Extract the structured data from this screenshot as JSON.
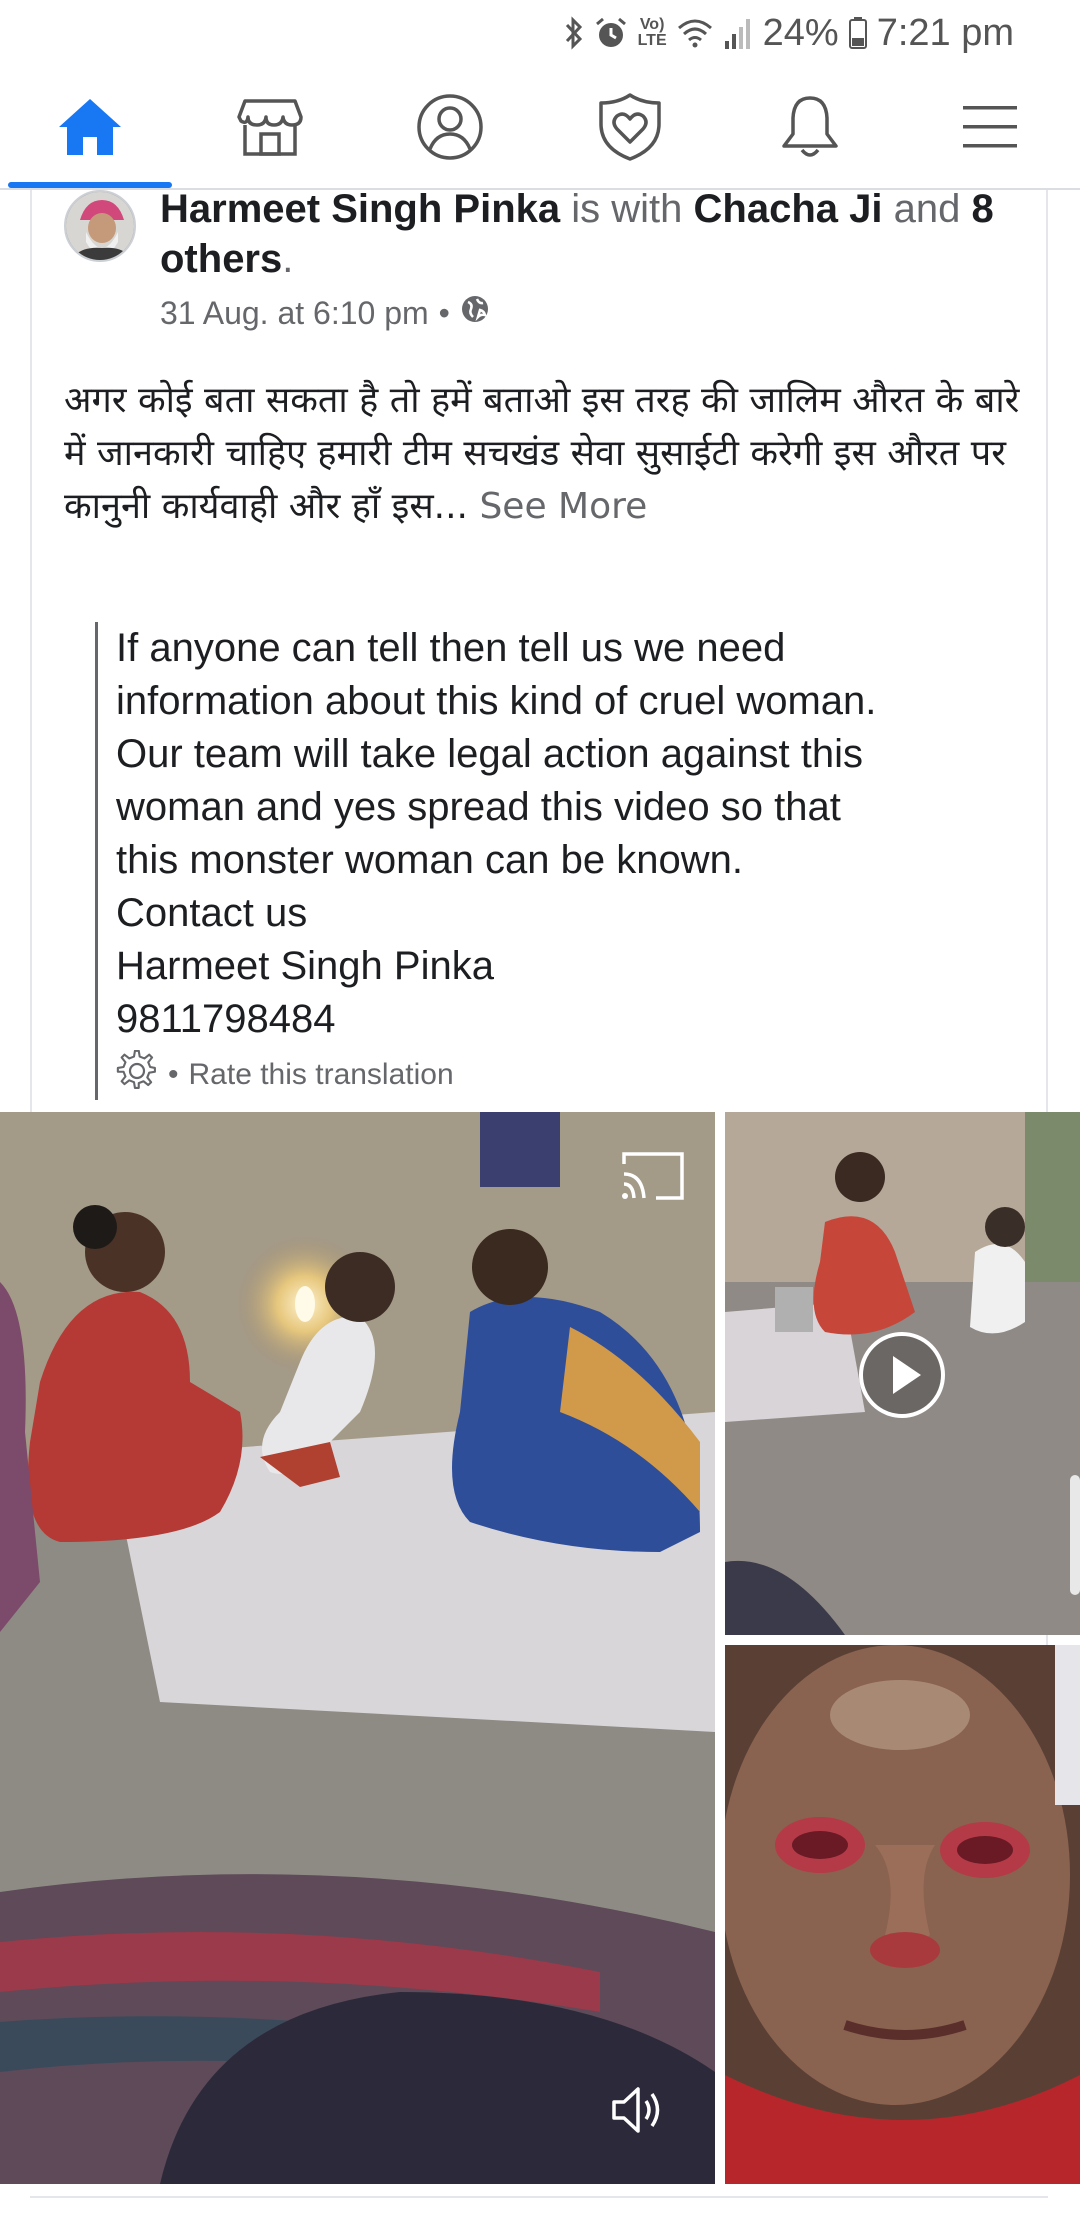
{
  "status_bar": {
    "battery": "24%",
    "time": "7:21 pm",
    "network_label_top": "Vo)",
    "network_label_bottom": "LTE",
    "icons": [
      "bluetooth-icon",
      "alarm-icon",
      "volte-icon",
      "wifi-icon",
      "signal-icon",
      "battery-icon"
    ]
  },
  "nav": {
    "items": [
      {
        "name": "home",
        "icon": "home-icon",
        "active": true
      },
      {
        "name": "marketplace",
        "icon": "marketplace-icon",
        "active": false
      },
      {
        "name": "profile",
        "icon": "profile-icon",
        "active": false
      },
      {
        "name": "dating",
        "icon": "heart-shield-icon",
        "active": false
      },
      {
        "name": "notifications",
        "icon": "bell-icon",
        "active": false
      },
      {
        "name": "menu",
        "icon": "menu-icon",
        "active": false
      }
    ],
    "accent_color": "#1877f2"
  },
  "post": {
    "author": "Harmeet Singh Pinka",
    "is_with_text": "is with",
    "tagged_person": "Chacha Ji",
    "and_text": "and",
    "others": "8 others",
    "period": ".",
    "timestamp": "31 Aug. at 6:10 pm",
    "separator": "•",
    "privacy_icon": "globe-icon",
    "text_hindi": "अगर कोई बता सकता है तो हमें बताओ इस तरह की जालिम औरत के बारे में जानकारी चाहिए हमारी टीम सचखंड सेवा सुसाईटी करेगी इस औरत पर कानुनी कार्यवाही और हाँ इस...",
    "see_more": "See More",
    "translation_lines": [
      "If anyone can tell then tell us we need",
      "information about this kind of cruel woman.",
      "Our team will take legal action against this",
      "woman and yes spread this video so that",
      "this monster woman can be known.",
      "Contact us",
      "Harmeet Singh Pinka",
      "9811798484"
    ],
    "rate_separator": "•",
    "rate_translation": "Rate this translation"
  },
  "media": {
    "main_icons": [
      "cast-icon",
      "volume-icon"
    ],
    "top_right_icon": "play-icon"
  }
}
